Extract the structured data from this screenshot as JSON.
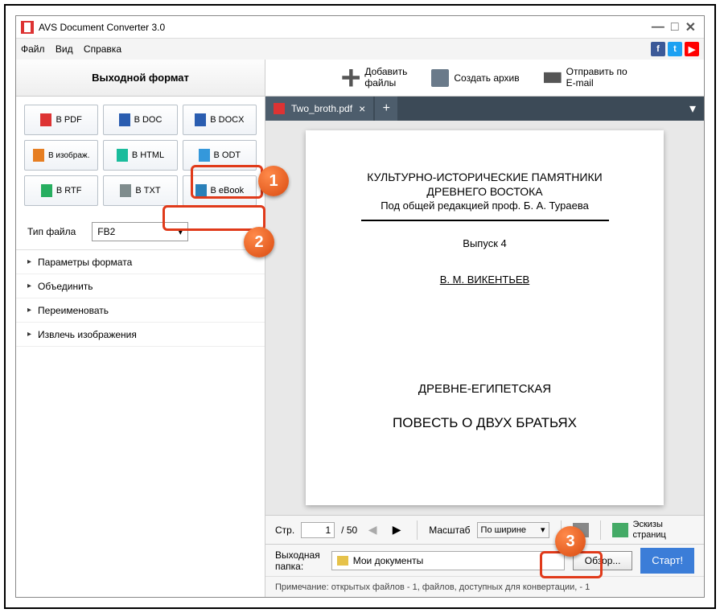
{
  "title": "AVS Document Converter 3.0",
  "menu": {
    "file": "Файл",
    "view": "Вид",
    "help": "Справка"
  },
  "top_actions": {
    "add": "Добавить\nфайлы",
    "archive": "Создать архив",
    "send": "Отправить по\nE-mail"
  },
  "sidebar": {
    "header": "Выходной формат",
    "formats": {
      "pdf": "В PDF",
      "doc": "В DOC",
      "docx": "В DOCX",
      "img": "В изображ.",
      "html": "В HTML",
      "odt": "В ODT",
      "rtf": "В RTF",
      "txt": "В TXT",
      "ebook": "В eBook"
    },
    "filetype_label": "Тип файла",
    "filetype_value": "FB2",
    "accordion": {
      "a1": "Параметры формата",
      "a2": "Объединить",
      "a3": "Переименовать",
      "a4": "Извлечь изображения"
    }
  },
  "tab": {
    "name": "Two_broth.pdf"
  },
  "doc": {
    "l1": "КУЛЬТУРНО-ИСТОРИЧЕСКИЕ ПАМЯТНИКИ",
    "l2": "ДРЕВНЕГО ВОСТОКА",
    "l3": "Под общей редакцией проф. Б. А. Тураева",
    "l4": "Выпуск 4",
    "l5": "В. М. ВИКЕНТЬЕВ",
    "l6": "ДРЕВНЕ-ЕГИПЕТСКАЯ",
    "l7": "ПОВЕСТЬ О ДВУХ БРАТЬЯХ"
  },
  "controls": {
    "page_label": "Стр.",
    "page_current": "1",
    "page_total": "/ 50",
    "zoom_label": "Масштаб",
    "zoom_value": "По ширине",
    "thumbs": "Эскизы\nстраниц"
  },
  "output": {
    "label": "Выходная папка:",
    "folder": "Мои документы",
    "browse": "Обзор...",
    "start": "Старт!"
  },
  "note": "Примечание: открытых файлов - 1, файлов, доступных для конвертации, - 1"
}
